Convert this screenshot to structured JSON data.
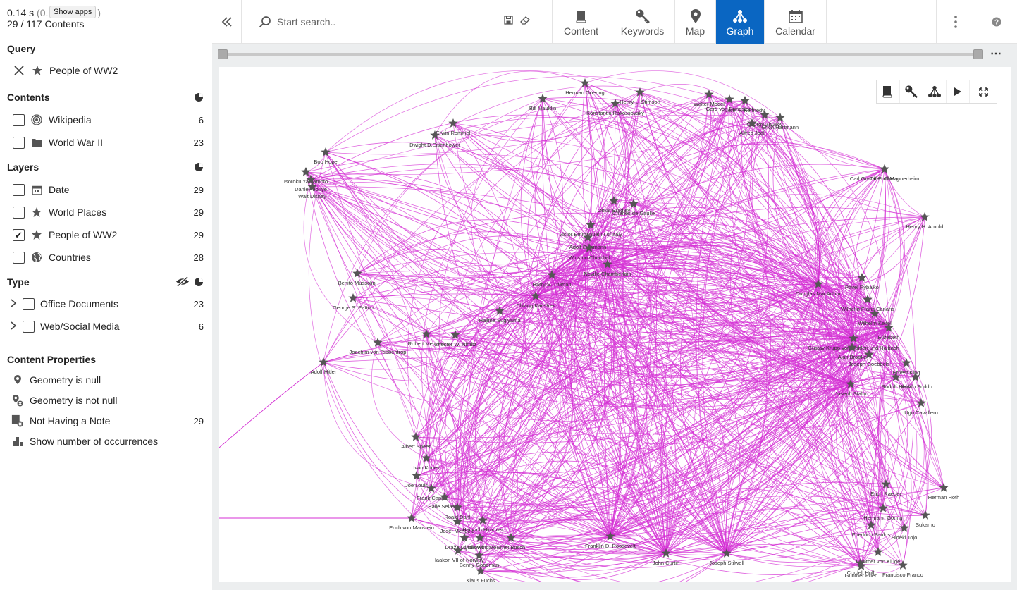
{
  "status": {
    "timing": "0.14 s",
    "timing_paren": "(0.",
    "timing_paren_close": ")",
    "tooltip": "Show apps",
    "counts": "29 / 117 Contents"
  },
  "query": {
    "title": "Query",
    "items": [
      {
        "label": "People of WW2"
      }
    ]
  },
  "contents": {
    "title": "Contents",
    "items": [
      {
        "label": "Wikipedia",
        "count": "6"
      },
      {
        "label": "World War II",
        "count": "23"
      }
    ]
  },
  "layers": {
    "title": "Layers",
    "items": [
      {
        "label": "Date",
        "count": "29",
        "checked": false
      },
      {
        "label": "World Places",
        "count": "29",
        "checked": false
      },
      {
        "label": "People of WW2",
        "count": "29",
        "checked": true,
        "check_mark": "✔"
      },
      {
        "label": "Countries",
        "count": "28",
        "checked": false
      }
    ]
  },
  "type": {
    "title": "Type",
    "items": [
      {
        "label": "Office Documents",
        "count": "23"
      },
      {
        "label": "Web/Social Media",
        "count": "6"
      }
    ]
  },
  "content_properties": {
    "title": "Content Properties",
    "items": [
      {
        "label": "Geometry is null",
        "count": ""
      },
      {
        "label": "Geometry is not null",
        "count": ""
      },
      {
        "label": "Not Having a Note",
        "count": "29"
      },
      {
        "label": "Show number of occurrences",
        "count": ""
      }
    ]
  },
  "toolbar": {
    "search_placeholder": "Start search..",
    "tabs": [
      {
        "label": "Content",
        "icon": "book-icon",
        "active": false
      },
      {
        "label": "Keywords",
        "icon": "key-icon",
        "active": false
      },
      {
        "label": "Map",
        "icon": "map-pin-icon",
        "active": false
      },
      {
        "label": "Graph",
        "icon": "graph-icon",
        "active": true
      },
      {
        "label": "Calendar",
        "icon": "calendar-icon",
        "active": false
      }
    ]
  },
  "colors": {
    "accent": "#0a66c2",
    "edge": "#d42fd4",
    "node": "#555555"
  },
  "graph": {
    "nodes": [
      {
        "label": "Herman Goering"
      },
      {
        "label": "Bill Mauldin"
      },
      {
        "label": "Henry L. Stimson"
      },
      {
        "label": "Konstantin Rokossovsky"
      },
      {
        "label": "Walter Model"
      },
      {
        "label": "Gerd von Rundstedt"
      },
      {
        "label": "John F. Kennedy"
      },
      {
        "label": "Georgy Zhukov"
      },
      {
        "label": "Alfred Jodl"
      },
      {
        "label": "Erich Hartmann"
      },
      {
        "label": "Carl Gustaf Emil Mannerheim"
      },
      {
        "label": "Chen Cheng"
      },
      {
        "label": "Erwin Rommel"
      },
      {
        "label": "Dwight D.Eisenhower"
      },
      {
        "label": "Bob Hope"
      },
      {
        "label": "Isoroku Yamamoto"
      },
      {
        "label": "Daniel Inouye"
      },
      {
        "label": "Walt Disney"
      },
      {
        "label": "Omar Bradley"
      },
      {
        "label": "Charles de Gaulle"
      },
      {
        "label": "Victor Emmanuel III of Italy"
      },
      {
        "label": "Adolf Eichmann"
      },
      {
        "label": "Henry H. Arnold"
      },
      {
        "label": "Winston Churchill"
      },
      {
        "label": "Neville Chamberlain"
      },
      {
        "label": "Benito Mussolini"
      },
      {
        "label": "Harry S. Truman"
      },
      {
        "label": "George S. Patton"
      },
      {
        "label": "Chiang Kai-shek"
      },
      {
        "label": "Hajime Sugiyama"
      },
      {
        "label": "Robert Menzies"
      },
      {
        "label": "Chester W. Nimitz"
      },
      {
        "label": "Joachim von Ribbentrop"
      },
      {
        "label": "Adolf Hitler"
      },
      {
        "label": "Douglas MacArthur"
      },
      {
        "label": "Pavel Rybalko"
      },
      {
        "label": "Wilhelm Franz Canaris"
      },
      {
        "label": "Wilhelm Keitel"
      },
      {
        "label": "Elizabeth"
      },
      {
        "label": "Gustav Krupp von Bohlen und Halbach"
      },
      {
        "label": "Alan Brooke"
      },
      {
        "label": "Joseph Goebbels"
      },
      {
        "label": "Ernest King"
      },
      {
        "label": "Rudolf Hess"
      },
      {
        "label": "Ubaldo Soddu"
      },
      {
        "label": "Joseph Stalin"
      },
      {
        "label": "Ugo Cavallero"
      },
      {
        "label": "Albert Speer"
      },
      {
        "label": "Ivan Konev"
      },
      {
        "label": "Joe Louis"
      },
      {
        "label": "Frank Capra"
      },
      {
        "label": "Haile Selassie"
      },
      {
        "label": "Roald Dahl"
      },
      {
        "label": "Josef Mengele"
      },
      {
        "label": "Heinrich Himmler"
      },
      {
        "label": "Erich von Manstein"
      },
      {
        "label": "Draža Mihailović"
      },
      {
        "label": "Haakon VII of Norway"
      },
      {
        "label": "Benny Goodman"
      },
      {
        "label": "Klaus Fuchs"
      },
      {
        "label": "Ernst Busch"
      },
      {
        "label": "Franklin D. Roosevelt"
      },
      {
        "label": "John Curtin"
      },
      {
        "label": "Joseph Stilwell"
      },
      {
        "label": "Erich Raeder"
      },
      {
        "label": "Hermann Göring"
      },
      {
        "label": "Herman Hoth"
      },
      {
        "label": "Sukarno"
      },
      {
        "label": "Hideki Tojo"
      },
      {
        "label": "Friedrich Paulus"
      },
      {
        "label": "Günther von Kluge"
      },
      {
        "label": "Gunther Prien"
      },
      {
        "label": "Cordell Hull"
      },
      {
        "label": "Francisco Franco"
      },
      {
        "label": "Qrde Wingate"
      }
    ]
  }
}
